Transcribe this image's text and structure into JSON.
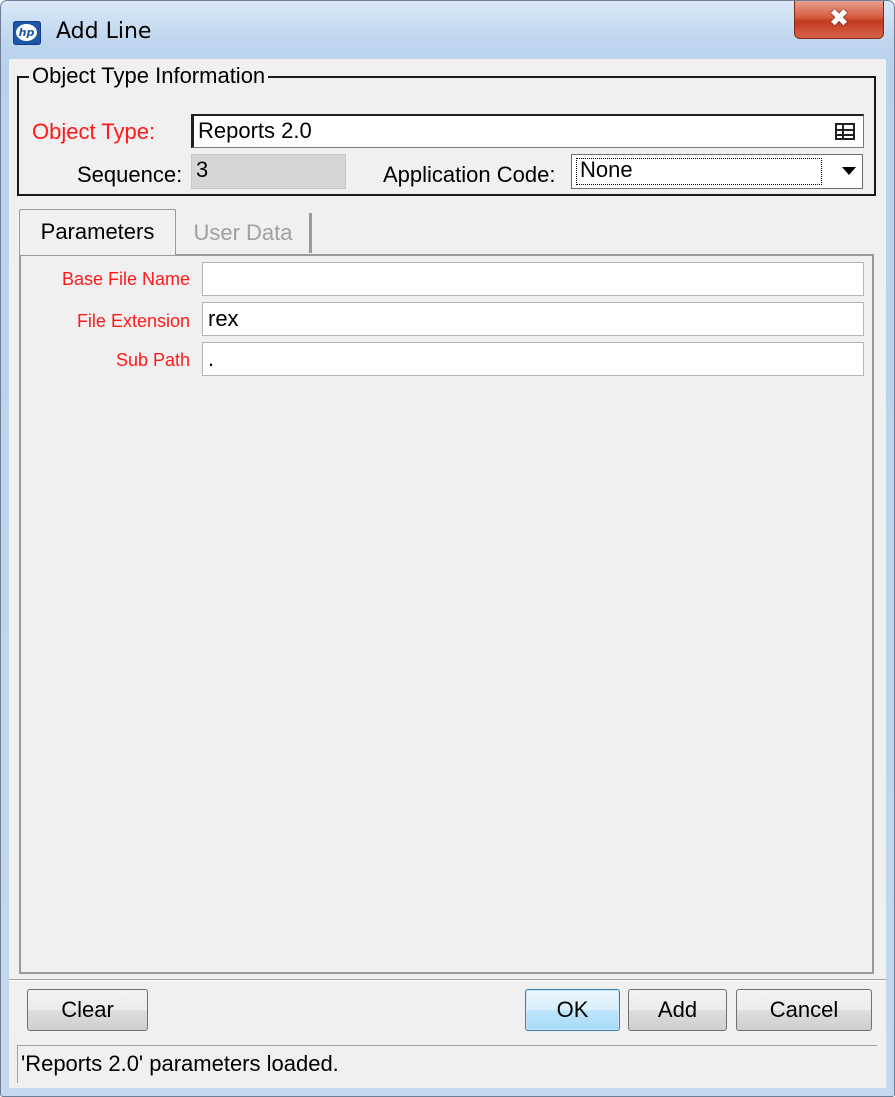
{
  "window": {
    "title": "Add Line",
    "app_icon": "hp-logo-icon",
    "close_glyph": "✖"
  },
  "object_type_group": {
    "legend": "Object Type Information",
    "object_type_label": "Object Type:",
    "object_type_value": "Reports 2.0",
    "object_type_icon": "table-lookup-icon",
    "sequence_label": "Sequence:",
    "sequence_value": "3",
    "application_code_label": "Application Code:",
    "application_code_value": "None"
  },
  "tabs": [
    {
      "label": "Parameters",
      "active": true
    },
    {
      "label": "User Data",
      "active": false
    }
  ],
  "parameters": [
    {
      "label": "Base File Name",
      "value": ""
    },
    {
      "label": "File Extension",
      "value": "rex"
    },
    {
      "label": "Sub Path",
      "value": "."
    }
  ],
  "buttons": {
    "clear": "Clear",
    "ok": "OK",
    "add": "Add",
    "cancel": "Cancel"
  },
  "status": {
    "text": "'Reports 2.0' parameters loaded."
  },
  "colors": {
    "required_label": "#ff1a1a",
    "disabled_tab": "#a0a0a0",
    "dialog_bg": "#f0f0f0"
  }
}
